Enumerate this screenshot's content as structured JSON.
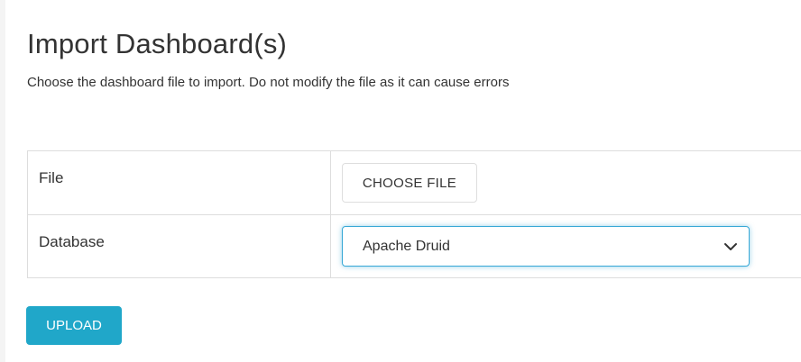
{
  "page": {
    "title": "Import Dashboard(s)",
    "subtitle": "Choose the dashboard file to import. Do not modify the file as it can cause errors"
  },
  "form": {
    "file": {
      "label": "File",
      "button_label": "CHOOSE FILE"
    },
    "database": {
      "label": "Database",
      "selected_value": "Apache Druid",
      "icon": "chevron-down-icon"
    }
  },
  "actions": {
    "upload_label": "UPLOAD"
  },
  "colors": {
    "primary_button": "#20a7c9",
    "focus_border": "#37a8d6",
    "table_border": "#dddddd",
    "text": "#333333"
  }
}
